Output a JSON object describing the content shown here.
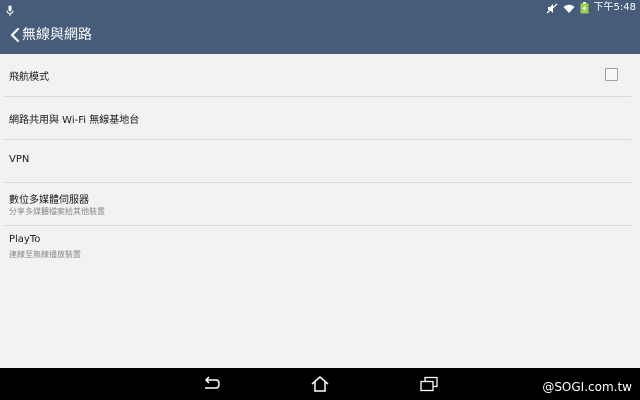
{
  "status_bar": {
    "time": "下午5:48",
    "icons": [
      "microphone-icon",
      "mute-icon",
      "wifi-icon",
      "battery-charging-icon"
    ]
  },
  "app_bar": {
    "title": "無線與網路",
    "back_icon": "chevron-left-icon"
  },
  "settings": {
    "items": [
      {
        "title": "飛航模式",
        "subtitle": "",
        "has_checkbox": true,
        "checked": false
      },
      {
        "title": "網路共用與 Wi-Fi 無線基地台",
        "subtitle": ""
      },
      {
        "title": "VPN",
        "subtitle": ""
      },
      {
        "title": "數位多媒體伺服器",
        "subtitle": "分享多媒體檔案給其他裝置"
      },
      {
        "title": "PlayTo",
        "subtitle": "連線至無線播放裝置"
      }
    ]
  },
  "nav_bar": {
    "buttons": [
      "back-icon",
      "home-icon",
      "recent-apps-icon"
    ]
  },
  "watermark": "@SOGI.com.tw",
  "colors": {
    "header": "#465c7a",
    "background": "#f2f2f2",
    "nav_bar": "#000000"
  }
}
